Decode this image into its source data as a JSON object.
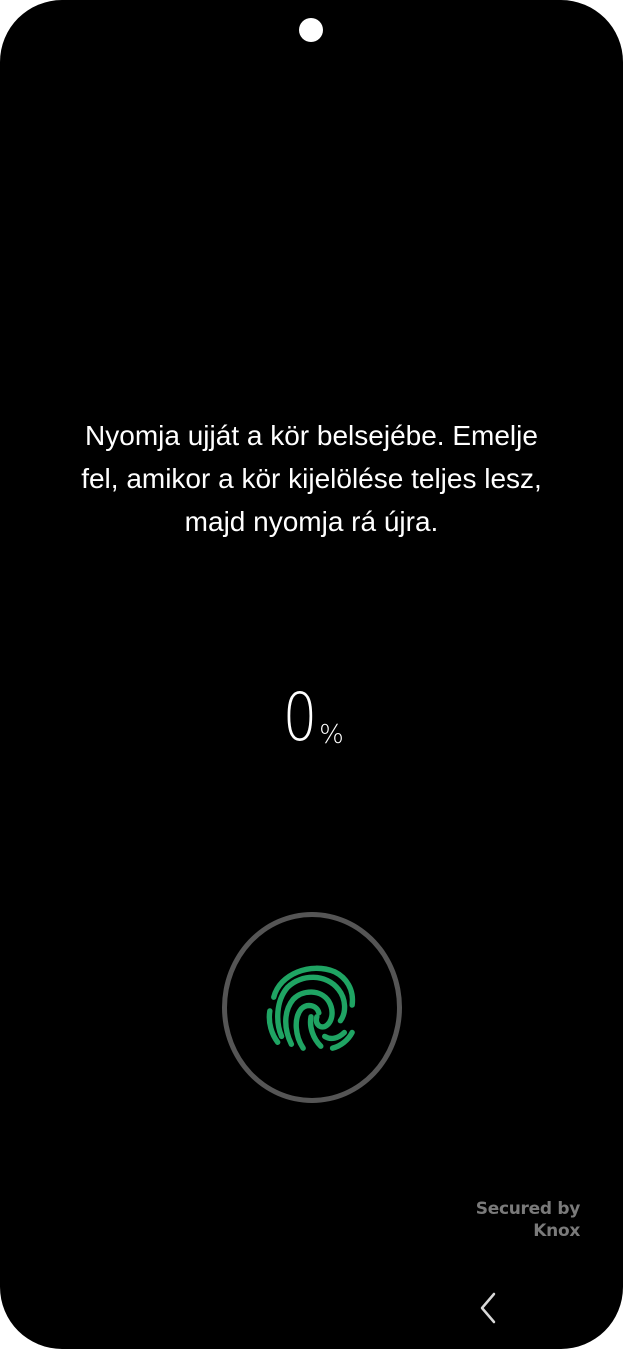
{
  "instruction": {
    "line1": "Nyomja ujját a kör belsejébe. Emelje",
    "line2": "fel, amikor a kör kijelölése teljes lesz,",
    "line3": "majd nyomja rá újra."
  },
  "progress": {
    "value": "0",
    "unit": "%"
  },
  "sensor": {
    "icon": "fingerprint-icon",
    "icon_color": "#1fa463",
    "ring_color": "#555555"
  },
  "branding": {
    "line1": "Secured by",
    "line2": "Knox"
  },
  "navigation": {
    "back_icon": "chevron-left-icon"
  }
}
